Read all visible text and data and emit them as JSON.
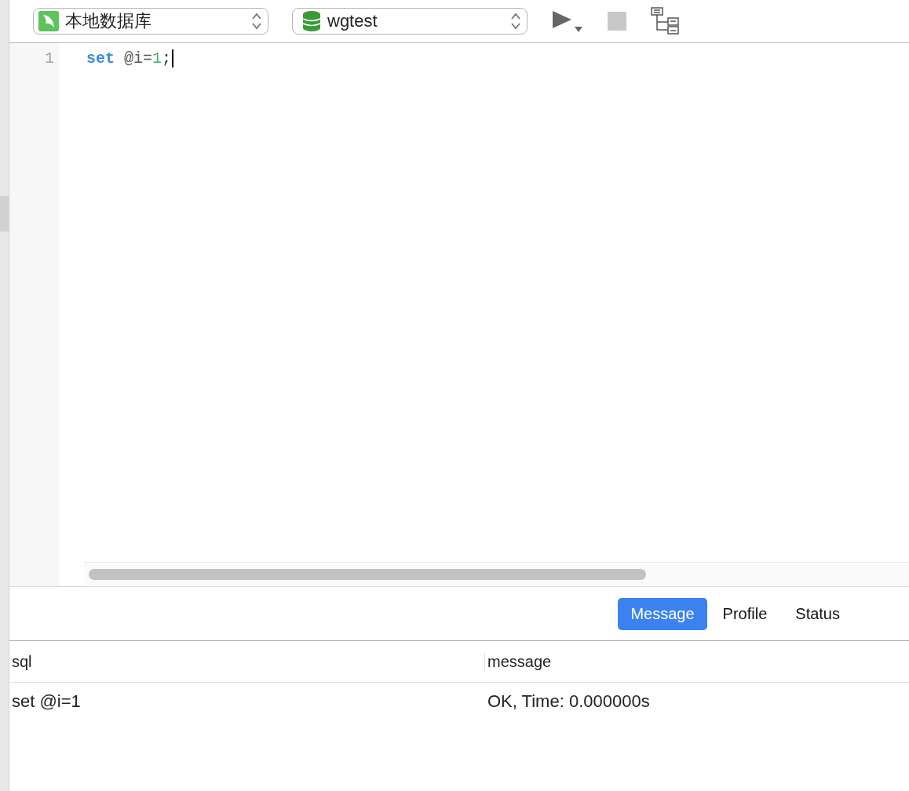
{
  "toolbar": {
    "connection": {
      "label": "本地数据库"
    },
    "database": {
      "label": "wgtest"
    }
  },
  "editor": {
    "lines": [
      {
        "number": "1",
        "tokens": [
          {
            "kind": "keyword",
            "text": "set"
          },
          {
            "kind": "plain",
            "text": " @i="
          },
          {
            "kind": "number",
            "text": "1"
          },
          {
            "kind": "punct",
            "text": ";"
          }
        ]
      }
    ]
  },
  "result_tabs": [
    {
      "label": "Message",
      "selected": true
    },
    {
      "label": "Profile",
      "selected": false
    },
    {
      "label": "Status",
      "selected": false
    }
  ],
  "table": {
    "columns": [
      "sql",
      "message"
    ],
    "rows": [
      [
        "set @i=1",
        "OK, Time: 0.000000s"
      ]
    ]
  }
}
